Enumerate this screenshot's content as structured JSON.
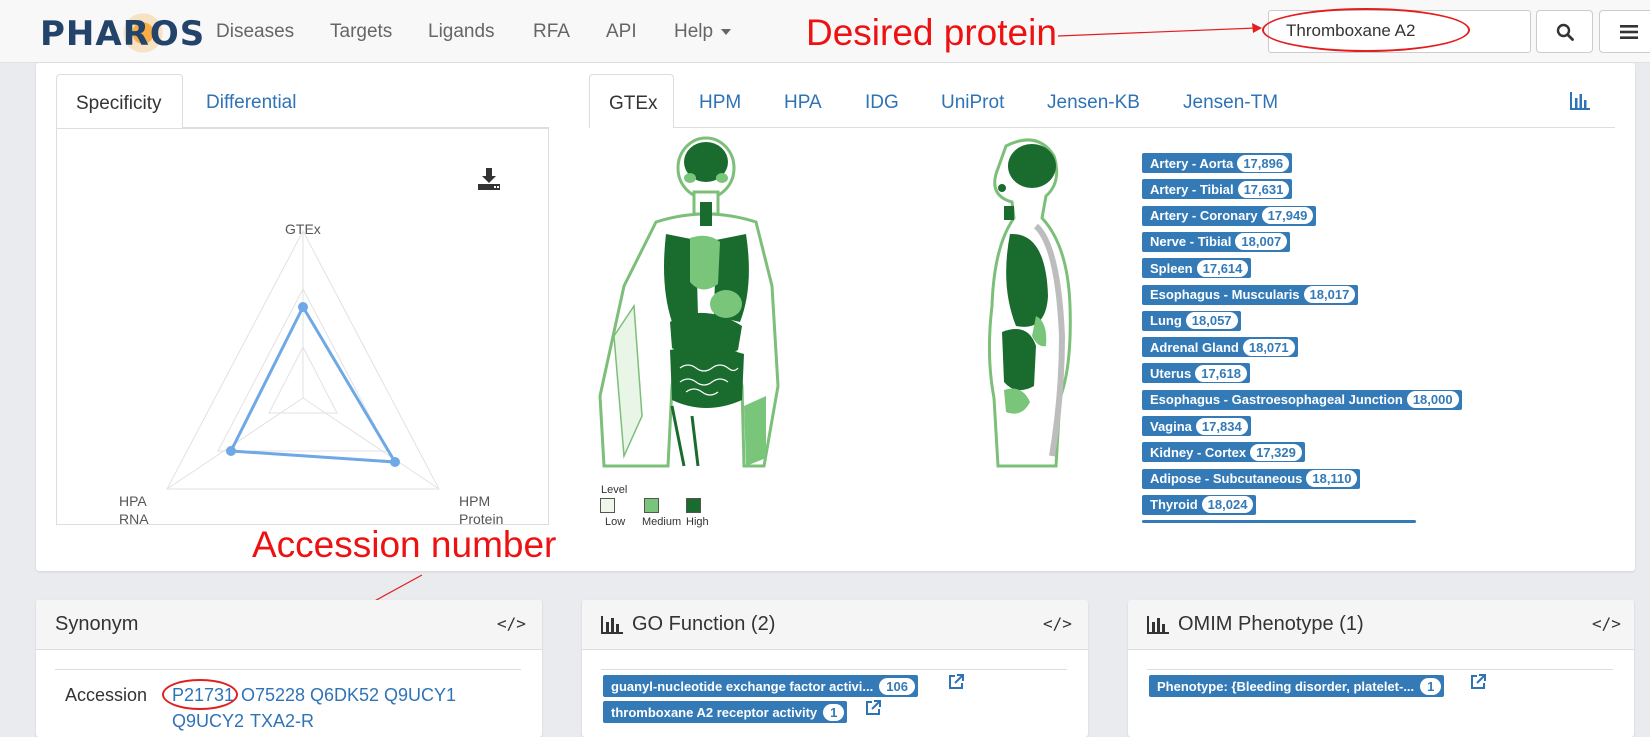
{
  "navbar": {
    "logo": "PHAROS",
    "menu": [
      "Diseases",
      "Targets",
      "Ligands",
      "RFA",
      "API",
      "Help"
    ],
    "search_value": "Thromboxane A2"
  },
  "annotations": {
    "desired_protein": "Desired protein",
    "accession_number": "Accession number"
  },
  "expression": {
    "left_tabs": [
      "Specificity",
      "Differential"
    ],
    "right_tabs": [
      "GTEx",
      "HPM",
      "HPA",
      "IDG",
      "UniProt",
      "Jensen-KB",
      "Jensen-TM"
    ],
    "radar_labels": {
      "top": "GTEx",
      "bottom_left_1": "HPA",
      "bottom_left_2": "RNA",
      "bottom_right_1": "HPM",
      "bottom_right_2": "Protein"
    },
    "legend": {
      "title": "Level",
      "low": "Low",
      "medium": "Medium",
      "high": "High"
    },
    "tissues": [
      {
        "name": "Artery - Aorta",
        "count": "17,896"
      },
      {
        "name": "Artery - Tibial",
        "count": "17,631"
      },
      {
        "name": "Artery - Coronary",
        "count": "17,949"
      },
      {
        "name": "Nerve - Tibial",
        "count": "18,007"
      },
      {
        "name": "Spleen",
        "count": "17,614"
      },
      {
        "name": "Esophagus - Muscularis",
        "count": "18,017"
      },
      {
        "name": "Lung",
        "count": "18,057"
      },
      {
        "name": "Adrenal Gland",
        "count": "18,071"
      },
      {
        "name": "Uterus",
        "count": "17,618"
      },
      {
        "name": "Esophagus - Gastroesophageal Junction",
        "count": "18,000"
      },
      {
        "name": "Vagina",
        "count": "17,834"
      },
      {
        "name": "Kidney - Cortex",
        "count": "17,329"
      },
      {
        "name": "Adipose - Subcutaneous",
        "count": "18,110"
      },
      {
        "name": "Thyroid",
        "count": "18,024"
      }
    ]
  },
  "synonym": {
    "title": "Synonym",
    "label": "Accession",
    "values": [
      "P21731",
      "O75228",
      "Q6DK52",
      "Q9UCY1",
      "Q9UCY2",
      "TXA2-R"
    ]
  },
  "go_function": {
    "title": "GO Function (2)",
    "items": [
      {
        "label": "guanyl-nucleotide exchange factor activi...",
        "count": "106"
      },
      {
        "label": "thromboxane A2 receptor activity",
        "count": "1"
      }
    ]
  },
  "omim": {
    "title": "OMIM Phenotype (1)",
    "items": [
      {
        "label": "Phenotype: {Bleeding disorder, platelet-...",
        "count": "1"
      }
    ]
  },
  "colors": {
    "link": "#2f73b7",
    "badge": "#337ab7",
    "annotation": "#ee1111",
    "level_low": "#eef7e9",
    "level_medium": "#79c57a",
    "level_high": "#1a6b2e"
  }
}
